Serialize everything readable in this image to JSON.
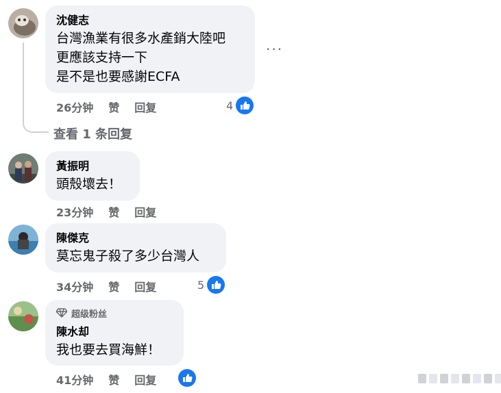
{
  "comments": [
    {
      "author": "沈健志",
      "lines": [
        "台灣漁業有很多水產銷大陸吧",
        "更應該支持一下",
        "是不是也要感謝ECFA"
      ],
      "time": "26分钟",
      "like_label": "赞",
      "reply_label": "回复",
      "like_count": "4",
      "view_replies": "查看 1 条回复",
      "more": "···"
    },
    {
      "author": "黃振明",
      "lines": [
        "頭殼壞去！"
      ],
      "time": "23分钟",
      "like_label": "赞",
      "reply_label": "回复"
    },
    {
      "author": "陳傑克",
      "lines": [
        "莫忘鬼子殺了多少台灣人"
      ],
      "time": "34分钟",
      "like_label": "赞",
      "reply_label": "回复",
      "like_count": "5"
    },
    {
      "badge": "超级粉丝",
      "author": "陳水却",
      "lines": [
        "我也要去買海鮮！"
      ],
      "time": "41分钟",
      "like_label": "赞",
      "reply_label": "回复"
    }
  ],
  "colors": {
    "accent": "#1877f2",
    "bubble": "#f0f2f5",
    "muted": "#65676b"
  },
  "icons": {
    "like": "thumbs-up-icon",
    "badge": "diamond-icon",
    "more": "more-dots-icon"
  }
}
